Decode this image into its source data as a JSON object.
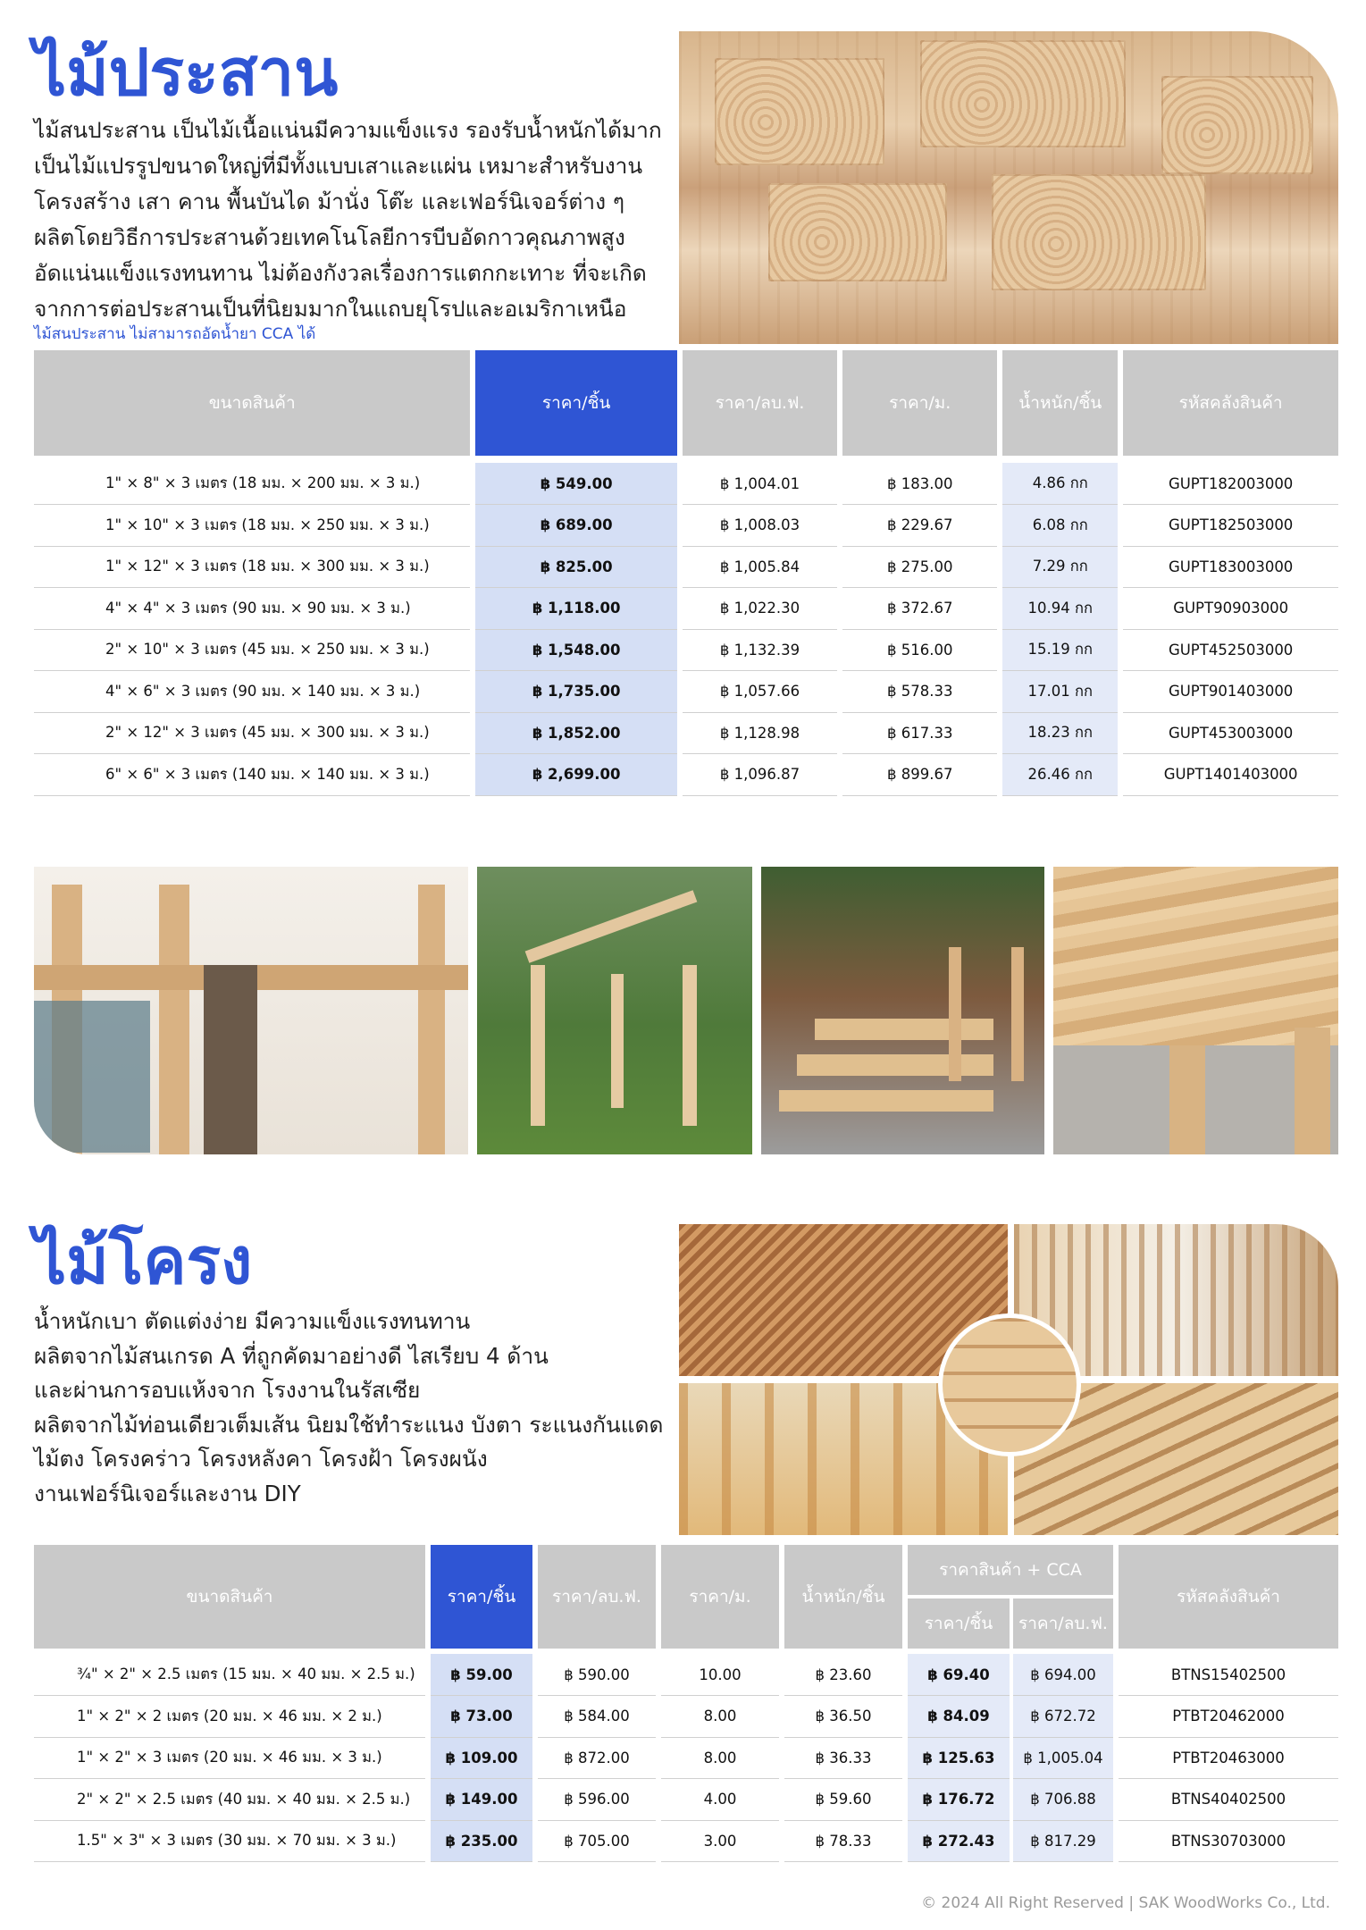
{
  "section1": {
    "title": "ไม้ประสาน",
    "desc": [
      "ไม้สนประสาน เป็นไม้เนื้อแน่นมีความแข็งแรง รองรับน้ำหนักได้มาก",
      "เป็นไม้แปรรูปขนาดใหญ่ที่มีทั้งแบบเสาและแผ่น เหมาะสำหรับงาน",
      "โครงสร้าง เสา คาน พื้นบันได ม้านั่ง โต๊ะ และเฟอร์นิเจอร์ต่าง ๆ",
      "ผลิตโดยวิธีการประสานด้วยเทคโนโลยีการบีบอัดกาวคุณภาพสูง",
      "อัดแน่นแข็งแรงทนทาน ไม่ต้องกังวลเรื่องการแตกกะเทาะ ที่จะเกิด",
      "จากการต่อประสานเป็นที่นิยมมากในแถบยุโรปและอเมริกาเหนือ"
    ],
    "note": "ไม้สนประสาน ไม่สามารถอัดน้ำยา CCA ได้",
    "headers": [
      "ขนาดสินค้า",
      "ราคา/ชิ้น",
      "ราคา/ลบ.ฟ.",
      "ราคา/ม.",
      "น้ำหนัก/ชิ้น",
      "รหัสคลังสินค้า"
    ],
    "rows": [
      [
        "1\" × 8\" × 3 เมตร (18 มม. × 200 มม. × 3 ม.)",
        "฿ 549.00",
        "฿ 1,004.01",
        "฿ 183.00",
        "4.86 กก",
        "GUPT182003000"
      ],
      [
        "1\" × 10\" × 3 เมตร (18 มม. × 250 มม. × 3 ม.)",
        "฿ 689.00",
        "฿ 1,008.03",
        "฿ 229.67",
        "6.08 กก",
        "GUPT182503000"
      ],
      [
        "1\" × 12\" × 3 เมตร (18 มม. × 300 มม. × 3 ม.)",
        "฿ 825.00",
        "฿ 1,005.84",
        "฿ 275.00",
        "7.29 กก",
        "GUPT183003000"
      ],
      [
        "4\" × 4\" × 3 เมตร (90 มม. × 90 มม. × 3 ม.)",
        "฿ 1,118.00",
        "฿ 1,022.30",
        "฿ 372.67",
        "10.94 กก",
        "GUPT90903000"
      ],
      [
        "2\" × 10\" × 3 เมตร (45 มม. × 250 มม. × 3 ม.)",
        "฿ 1,548.00",
        "฿ 1,132.39",
        "฿ 516.00",
        "15.19 กก",
        "GUPT452503000"
      ],
      [
        "4\" × 6\" × 3 เมตร (90 มม. × 140 มม. × 3 ม.)",
        "฿ 1,735.00",
        "฿ 1,057.66",
        "฿ 578.33",
        "17.01 กก",
        "GUPT901403000"
      ],
      [
        "2\" × 12\" × 3 เมตร (45 มม. × 300 มม. × 3 ม.)",
        "฿ 1,852.00",
        "฿ 1,128.98",
        "฿ 617.33",
        "18.23 กก",
        "GUPT453003000"
      ],
      [
        "6\" × 6\" × 3 เมตร (140 มม. × 140 มม. × 3 ม.)",
        "฿ 2,699.00",
        "฿ 1,096.87",
        "฿ 899.67",
        "26.46 กก",
        "GUPT1401403000"
      ]
    ]
  },
  "section2": {
    "title": "ไม้โครง",
    "desc": [
      "น้ำหนักเบา ตัดแต่งง่าย มีความแข็งแรงทนทาน",
      "ผลิตจากไม้สนเกรด A ที่ถูกคัดมาอย่างดี ไสเรียบ 4 ด้าน",
      "และผ่านการอบแห้งจาก โรงงานในรัสเซีย",
      "ผลิตจากไม้ท่อนเดียวเต็มเส้น นิยมใช้ทำระแนง บังตา ระแนงกันแดด",
      "ไม้ตง โครงคร่าว โครงหลังคา โครงฝ้า โครงผนัง",
      "งานเฟอร์นิเจอร์และงาน DIY"
    ],
    "headers": [
      "ขนาดสินค้า",
      "ราคา/ชิ้น",
      "ราคา/ลบ.ฟ.",
      "ราคา/ม.",
      "น้ำหนัก/ชิ้น",
      "ราคาสินค้า + CCA",
      "รหัสคลังสินค้า"
    ],
    "subheaders": [
      "ราคา/ชิ้น",
      "ราคา/ลบ.ฟ."
    ],
    "rows": [
      [
        "¾\" × 2\" × 2.5 เมตร (15 มม. × 40 มม. × 2.5 ม.)",
        "฿ 59.00",
        "฿ 590.00",
        "10.00",
        "฿ 23.60",
        "฿ 69.40",
        "฿ 694.00",
        "BTNS15402500"
      ],
      [
        "1\" × 2\" × 2 เมตร (20 มม. × 46 มม. × 2 ม.)",
        "฿ 73.00",
        "฿ 584.00",
        "8.00",
        "฿ 36.50",
        "฿ 84.09",
        "฿ 672.72",
        "PTBT20462000"
      ],
      [
        "1\" × 2\" × 3 เมตร (20 มม. × 46 มม. × 3 ม.)",
        "฿ 109.00",
        "฿ 872.00",
        "8.00",
        "฿ 36.33",
        "฿ 125.63",
        "฿ 1,005.04",
        "PTBT20463000"
      ],
      [
        "2\" × 2\" × 2.5 เมตร (40 มม. × 40 มม. × 2.5 ม.)",
        "฿ 149.00",
        "฿ 596.00",
        "4.00",
        "฿ 59.60",
        "฿ 176.72",
        "฿ 706.88",
        "BTNS40402500"
      ],
      [
        "1.5\" × 3\" × 3 เมตร (30 มม. × 70 มม. × 3 ม.)",
        "฿ 235.00",
        "฿ 705.00",
        "3.00",
        "฿ 78.33",
        "฿ 272.43",
        "฿ 817.29",
        "BTNS30703000"
      ]
    ]
  },
  "footer": "© 2024 All Right Reserved | SAK WoodWorks Co., Ltd."
}
